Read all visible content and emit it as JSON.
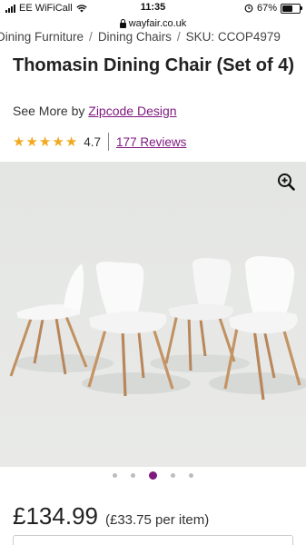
{
  "status_bar": {
    "carrier": "EE WiFiCall",
    "time": "11:35",
    "battery": "67%",
    "battery_level": 0.67
  },
  "browser": {
    "url": "wayfair.co.uk"
  },
  "breadcrumb": {
    "items": [
      "Dining Furniture",
      "Dining Chairs",
      "SKU: CCOP4979"
    ],
    "separator": "/"
  },
  "product": {
    "title": "Thomasin Dining Chair (Set of 4)",
    "see_more_prefix": "See More by",
    "brand": "Zipcode Design",
    "rating": "4.7",
    "rating_value": 4.7,
    "reviews": "177 Reviews",
    "price": "£134.99",
    "price_per_item": "(£33.75 per item)"
  },
  "gallery": {
    "dot_count": 5,
    "active_index": 2
  },
  "colors": {
    "accent": "#7f187f",
    "star": "#f2a81f",
    "image_bg": "#e6e8e6"
  },
  "icons": [
    "signal-icon",
    "wifi-icon",
    "lock-icon",
    "alarm-icon",
    "battery-icon",
    "star-icon",
    "zoom-in-icon"
  ]
}
